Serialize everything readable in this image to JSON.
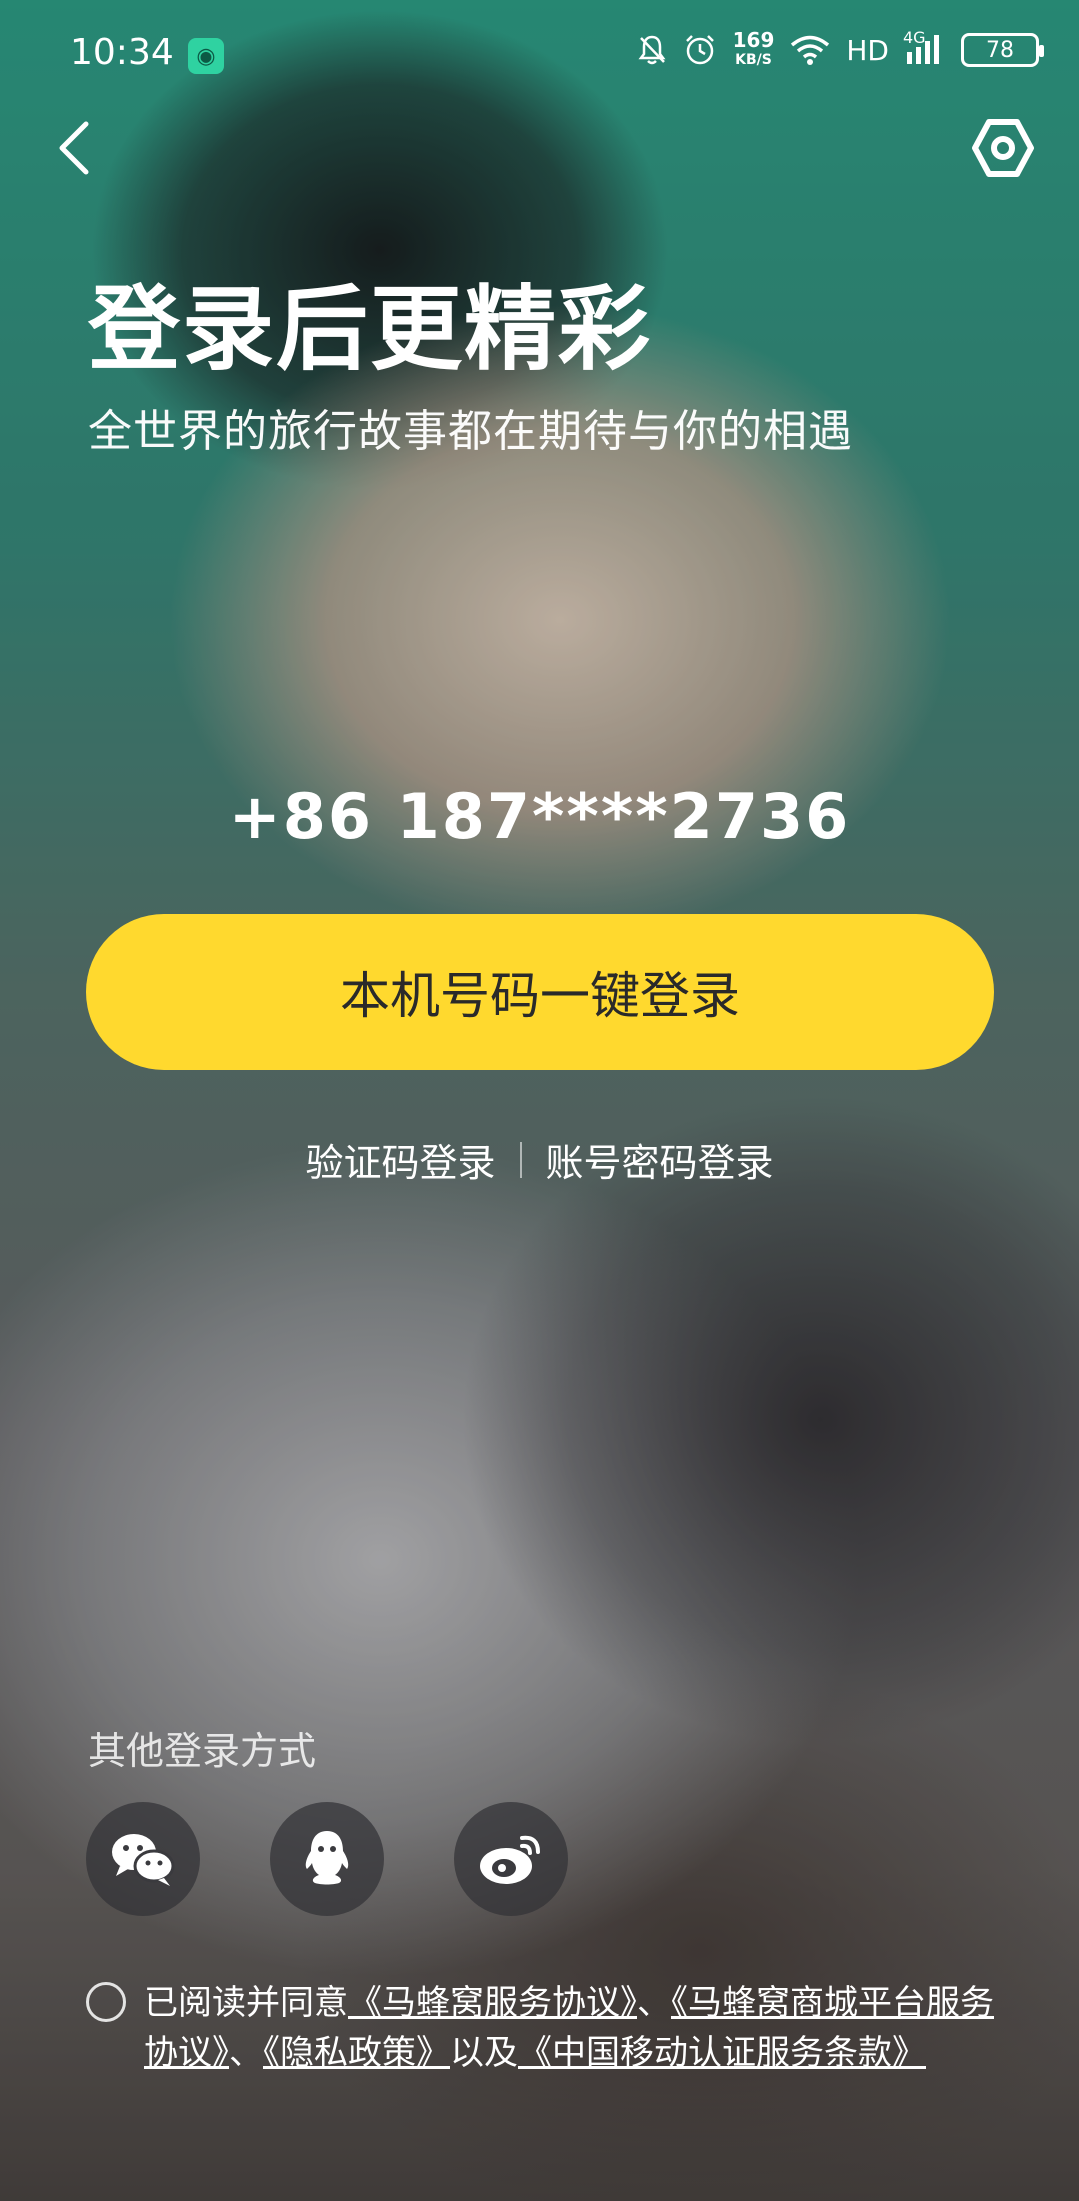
{
  "status_bar": {
    "time": "10:34",
    "speed_value": "169",
    "speed_unit": "KB/S",
    "hd": "HD",
    "network": "4G",
    "battery": "78"
  },
  "header": {
    "title": "登录后更精彩",
    "subtitle": "全世界的旅行故事都在期待与你的相遇"
  },
  "phone_number": "+86 187****2736",
  "primary_button": "本机号码一键登录",
  "alt_login": {
    "sms": "验证码登录",
    "password": "账号密码登录"
  },
  "other_methods": {
    "label": "其他登录方式",
    "icons": [
      "wechat-icon",
      "qq-icon",
      "weibo-icon"
    ]
  },
  "agreement": {
    "prefix": "已阅读并同意",
    "link1": "《马蜂窝服务协议》",
    "sep1": "、",
    "link2": "《马蜂窝商城平台服务协议》",
    "sep2": "、",
    "link3": "《隐私政策》",
    "mid": "以及",
    "link4": "《中国移动认证服务条款》"
  },
  "colors": {
    "accent": "#ffd92e",
    "text": "#ffffff"
  }
}
